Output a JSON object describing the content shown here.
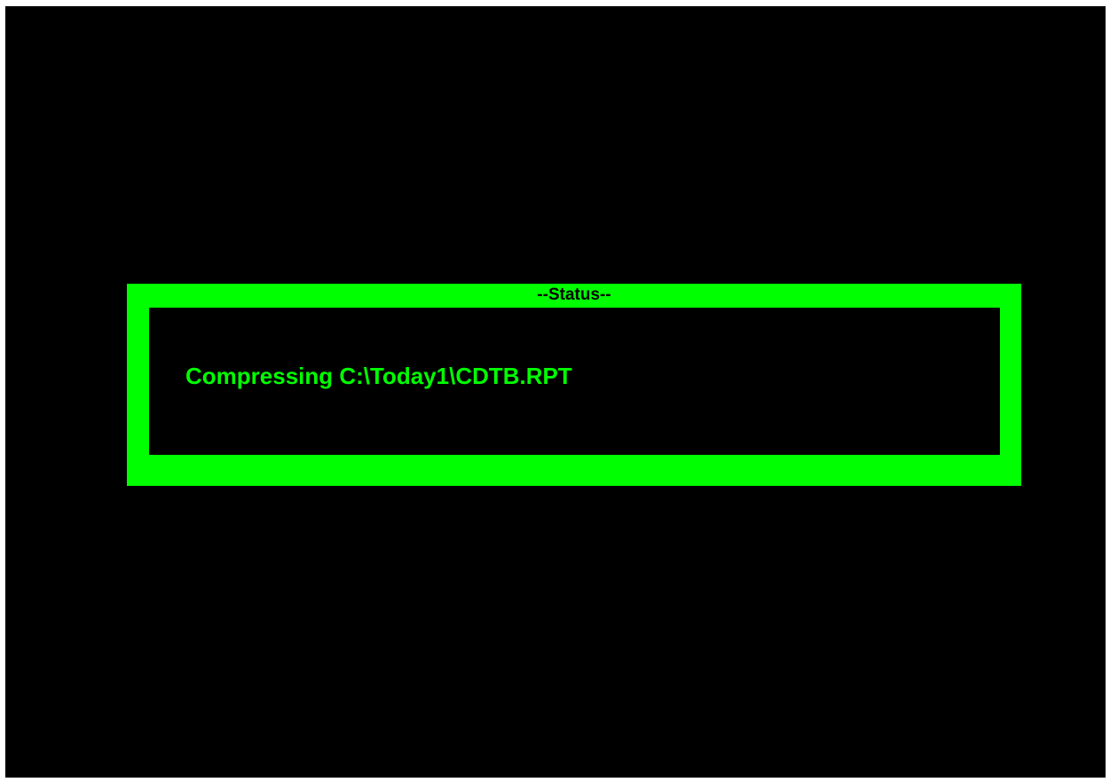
{
  "status_panel": {
    "title": "--Status--",
    "message": "Compressing C:\\Today1\\CDTB.RPT"
  },
  "colors": {
    "screen_background": "#000000",
    "accent": "#00ff00",
    "title_text": "#000000"
  }
}
